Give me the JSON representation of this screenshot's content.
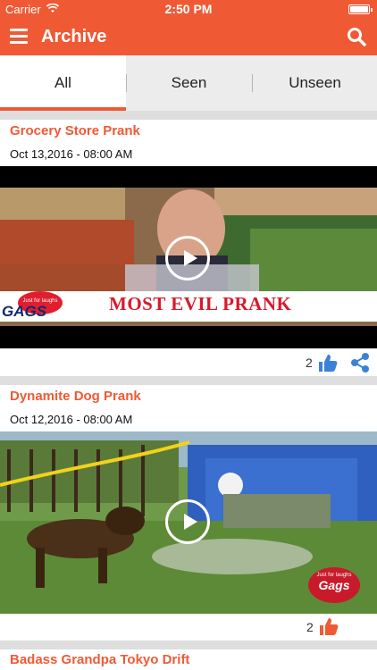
{
  "status_bar": {
    "carrier": "Carrier",
    "time": "2:50 PM"
  },
  "header": {
    "title": "Archive",
    "menu_icon": "hamburger-menu-icon",
    "search_icon": "search-icon"
  },
  "tabs": [
    {
      "label": "All",
      "active": true
    },
    {
      "label": "Seen",
      "active": false
    },
    {
      "label": "Unseen",
      "active": false
    }
  ],
  "accent_color": "#ef5a35",
  "feed": [
    {
      "title": "Grocery Store Prank",
      "date": "Oct 13,2016 - 08:00 AM",
      "likes": "2",
      "like_color": "#3b82d6",
      "has_share": true,
      "thumbnail_caption_brand": "GAGS",
      "thumbnail_caption_text": "MOST EVIL PRANK",
      "thumbnail_badge": "Just for laughs"
    },
    {
      "title": "Dynamite Dog Prank",
      "date": "Oct 12,2016 - 08:00 AM",
      "likes": "2",
      "like_color": "#ef5a35",
      "has_share": false,
      "thumbnail_badge": "Just for laughs",
      "thumbnail_caption_brand": "Gags"
    },
    {
      "title": "Badass Grandpa Tokyo Drift"
    }
  ]
}
